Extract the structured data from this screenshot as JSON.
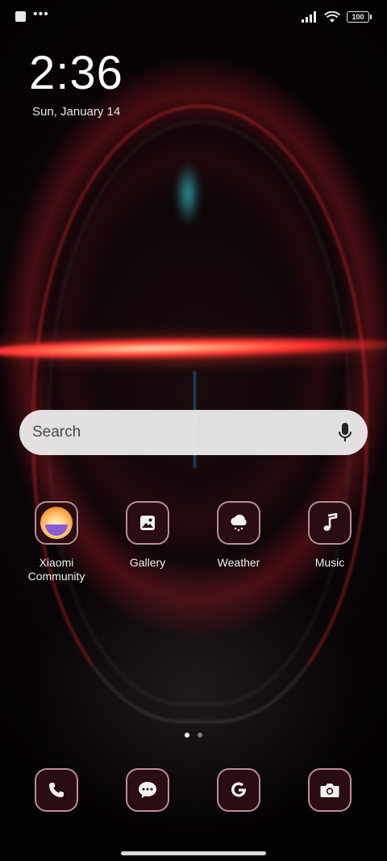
{
  "status_bar": {
    "left_icons": [
      "notification-square-icon",
      "more-dots-icon"
    ],
    "more_text": "•••",
    "right_icons": [
      "signal-icon",
      "wifi-icon",
      "battery-icon"
    ],
    "battery_level": "100"
  },
  "clock": {
    "time": "2:36",
    "date": "Sun, January 14"
  },
  "search": {
    "placeholder": "Search",
    "mic_icon": "microphone-icon"
  },
  "apps": [
    {
      "label": "Xiaomi\nCommunity",
      "icon": "xiaomi-community-icon"
    },
    {
      "label": "Gallery",
      "icon": "gallery-icon"
    },
    {
      "label": "Weather",
      "icon": "weather-icon"
    },
    {
      "label": "Music",
      "icon": "music-icon"
    }
  ],
  "pager": {
    "pages": 2,
    "current": 1
  },
  "dock": [
    {
      "icon": "phone-icon"
    },
    {
      "icon": "messages-icon"
    },
    {
      "icon": "google-icon"
    },
    {
      "icon": "camera-icon"
    }
  ],
  "colors": {
    "tile_background": "#2a0d12",
    "tile_border": "#b98f95",
    "search_background": "#eeeeee",
    "wallpaper_red": "#ff2e2e"
  }
}
